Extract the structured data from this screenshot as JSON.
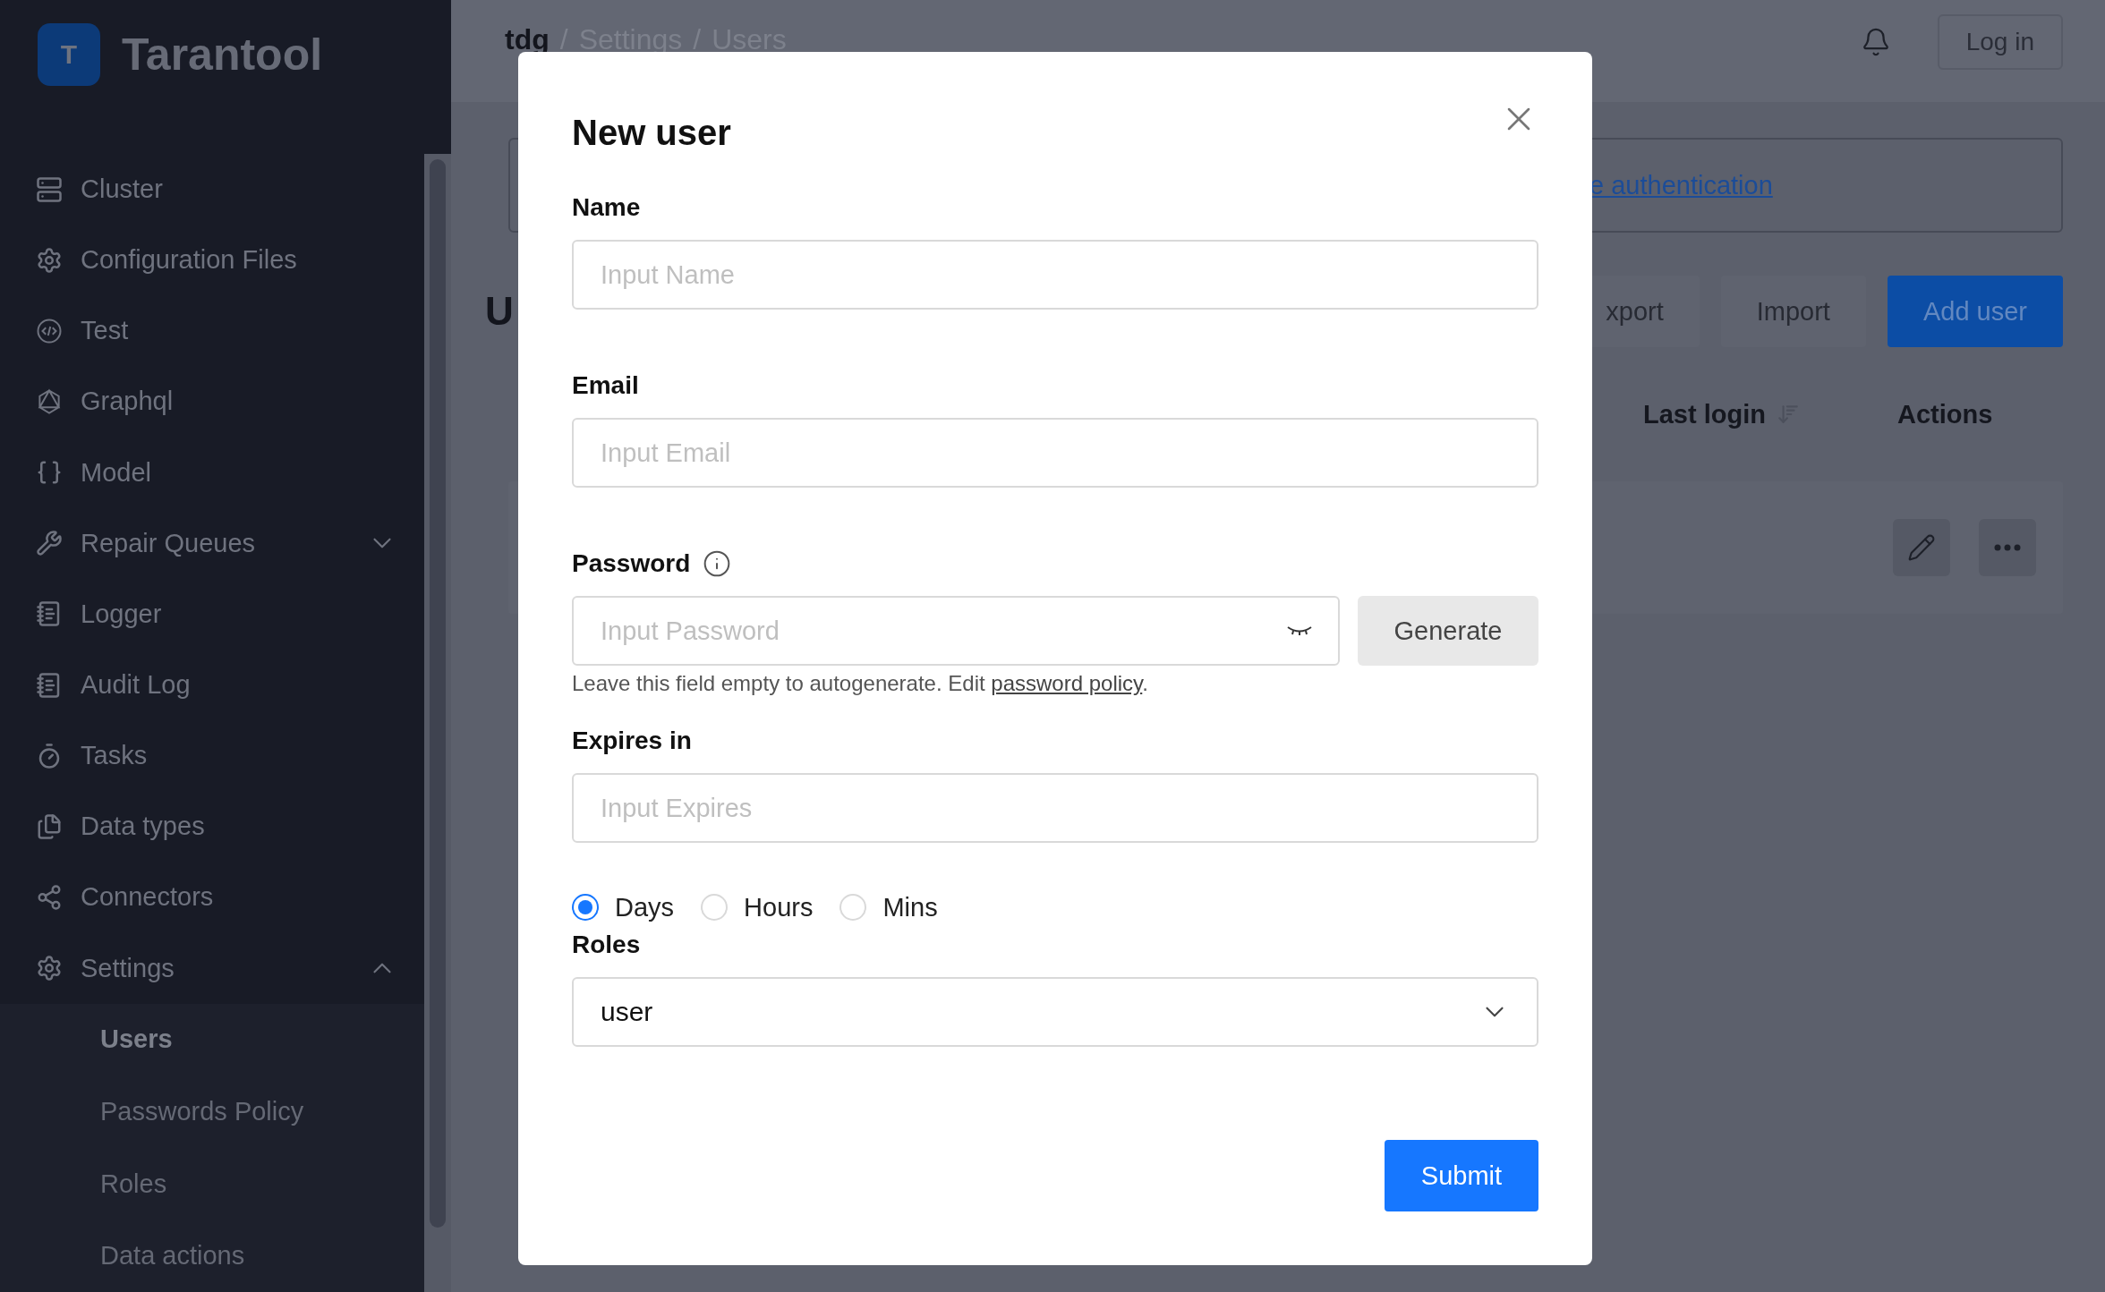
{
  "sidebar": {
    "logo": "T",
    "title": "Tarantool",
    "items": [
      {
        "label": "Cluster",
        "kind": "link"
      },
      {
        "label": "Configuration Files",
        "kind": "link"
      },
      {
        "label": "Test",
        "kind": "link"
      },
      {
        "label": "Graphql",
        "kind": "link"
      },
      {
        "label": "Model",
        "kind": "link"
      },
      {
        "label": "Repair Queues",
        "kind": "group",
        "expanded": false
      },
      {
        "label": "Logger",
        "kind": "link"
      },
      {
        "label": "Audit Log",
        "kind": "link"
      },
      {
        "label": "Tasks",
        "kind": "link"
      },
      {
        "label": "Data types",
        "kind": "link"
      },
      {
        "label": "Connectors",
        "kind": "link"
      },
      {
        "label": "Settings",
        "kind": "group",
        "expanded": true,
        "children": [
          {
            "label": "Users",
            "selected": true
          },
          {
            "label": "Passwords Policy",
            "selected": false
          },
          {
            "label": "Roles",
            "selected": false
          },
          {
            "label": "Data actions",
            "selected": false
          }
        ]
      }
    ]
  },
  "header": {
    "breadcrumb": [
      "tdg",
      "Settings",
      "Users"
    ],
    "separator": "/",
    "login": "Log in"
  },
  "page": {
    "notice_link": "e authentication",
    "title": "U",
    "buttons": [
      {
        "label": "xport",
        "kind": "secondary"
      },
      {
        "label": "Import",
        "kind": "secondary"
      },
      {
        "label": "Add user",
        "kind": "primary"
      }
    ],
    "columns": [
      "Last login",
      "Actions"
    ]
  },
  "modal": {
    "title": "New user",
    "name": {
      "label": "Name",
      "placeholder": "Input Name"
    },
    "email": {
      "label": "Email",
      "placeholder": "Input Email"
    },
    "password": {
      "label": "Password",
      "placeholder": "Input Password",
      "button": "Generate",
      "hint": "Leave this field empty to autogenerate. Edit ",
      "hint_link": "password policy",
      "hint_end": "."
    },
    "expires": {
      "label": "Expires in",
      "placeholder": "Input Expires",
      "units": [
        {
          "label": "Days",
          "selected": true
        },
        {
          "label": "Hours",
          "selected": false
        },
        {
          "label": "Mins",
          "selected": false
        }
      ]
    },
    "roles": {
      "label": "Roles",
      "value": "user"
    },
    "submit": "Submit"
  }
}
